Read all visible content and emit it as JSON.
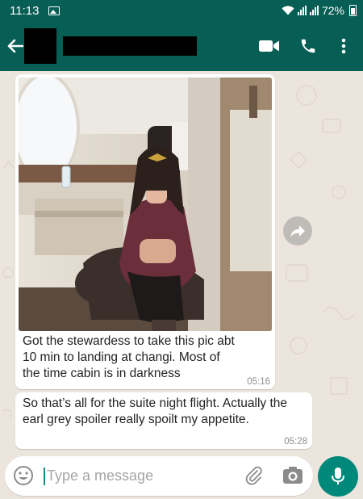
{
  "status_bar": {
    "time": "11:13",
    "battery": "72%"
  },
  "header": {
    "contact_name_redacted": true,
    "icons": [
      "back-arrow-icon",
      "video-call-icon",
      "phone-icon",
      "more-vert-icon"
    ]
  },
  "messages": [
    {
      "type": "photo",
      "direction": "incoming",
      "caption": "Got the stewardess to take this pic abt 10 min to landing at changi. Most of the time cabin is in darkness",
      "time": "05:16"
    },
    {
      "type": "text",
      "direction": "incoming",
      "body": "So that’s all for the suite night flight. Actually the earl grey spoiler really spoilt my appetite.",
      "time": "05:28"
    }
  ],
  "composer": {
    "placeholder": "Type a message",
    "value": ""
  },
  "colors": {
    "header": "#075e54",
    "chat_background": "#ece5dd",
    "bubble": "#ffffff",
    "mic_button": "#00897b"
  }
}
